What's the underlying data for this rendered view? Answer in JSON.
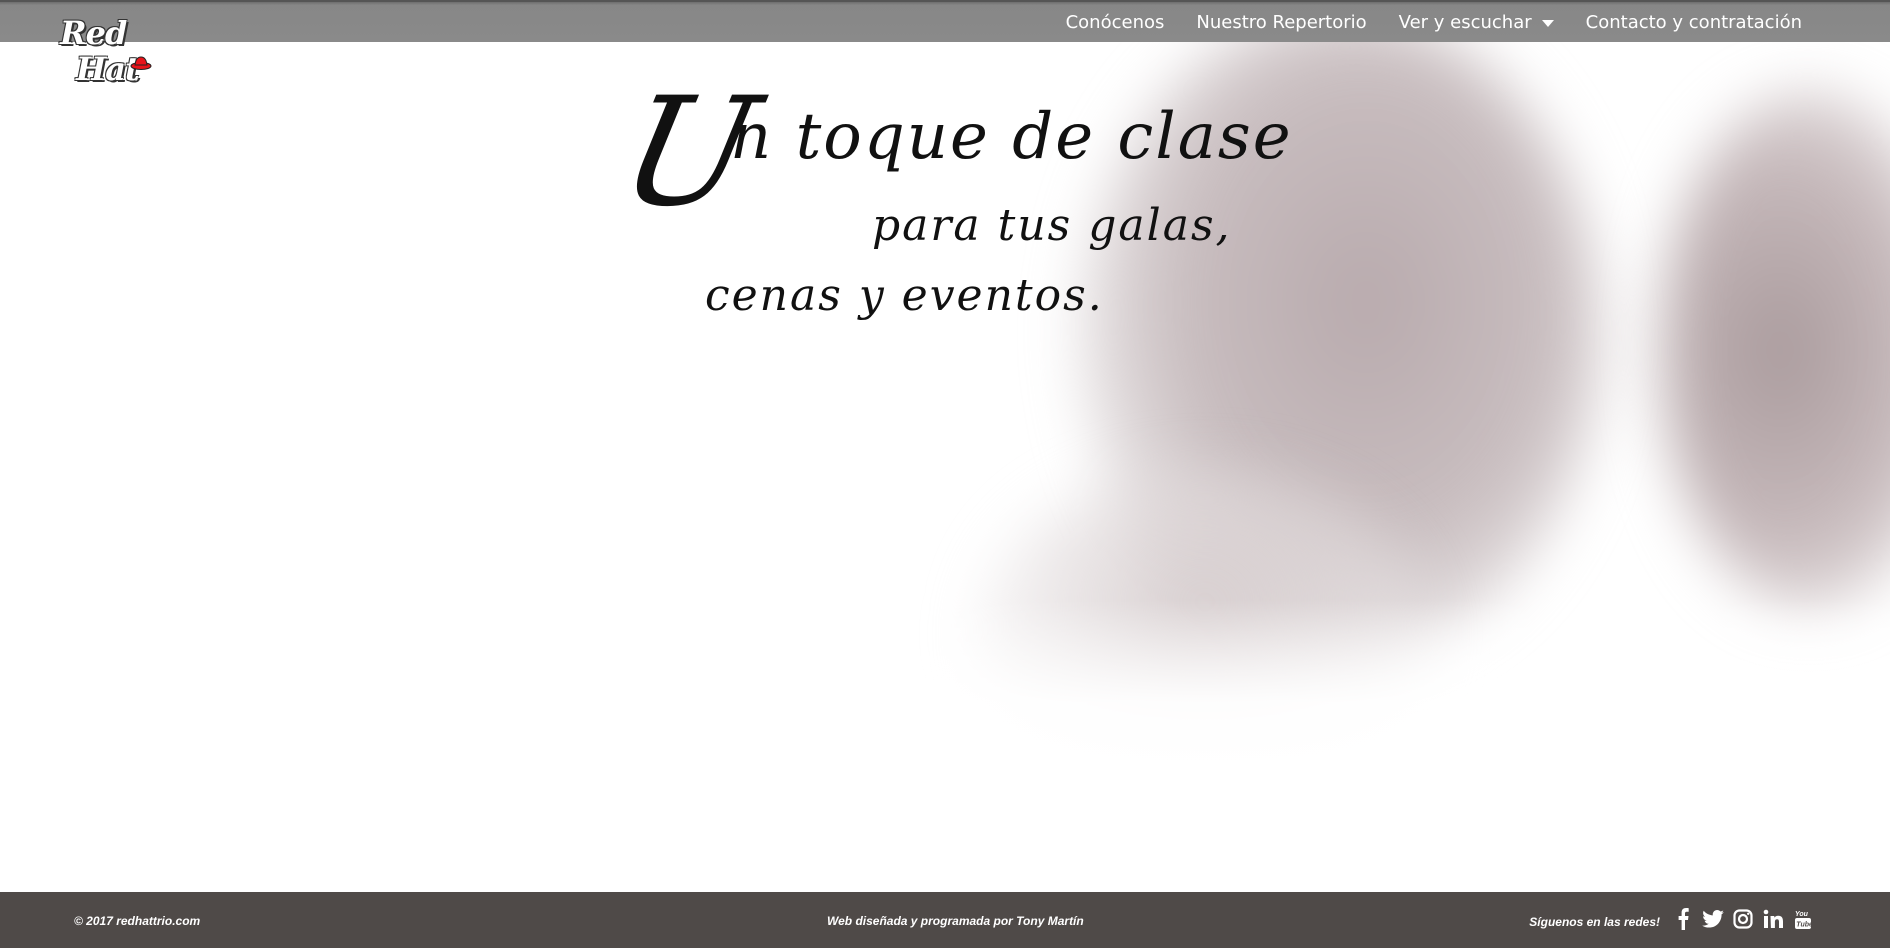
{
  "logo": {
    "line1": "Red",
    "line2": "Hat",
    "hat_color": "#e8141b"
  },
  "nav": {
    "items": [
      {
        "label": "Conócenos"
      },
      {
        "label": "Nuestro Repertorio"
      },
      {
        "label": "Ver y escuchar",
        "has_dropdown": true
      },
      {
        "label": "Contacto y contratación"
      }
    ]
  },
  "hero": {
    "cap": "U",
    "line1": "n toque de clase",
    "line2": "para tus galas,",
    "line3": "cenas y eventos."
  },
  "footer": {
    "copyright": "© 2017 redhattrio.com",
    "credit_prefix": "Web diseñada y programada por ",
    "credit_author": "Tony Martín",
    "follow_text": "Síguenos en las redes!",
    "social_icons": [
      "facebook-icon",
      "twitter-icon",
      "instagram-icon",
      "linkedin-icon",
      "youtube-icon"
    ]
  },
  "colors": {
    "navbar": "#8a8a8a",
    "footer": "#4f4a48",
    "text_on_dark": "#ffffff"
  }
}
